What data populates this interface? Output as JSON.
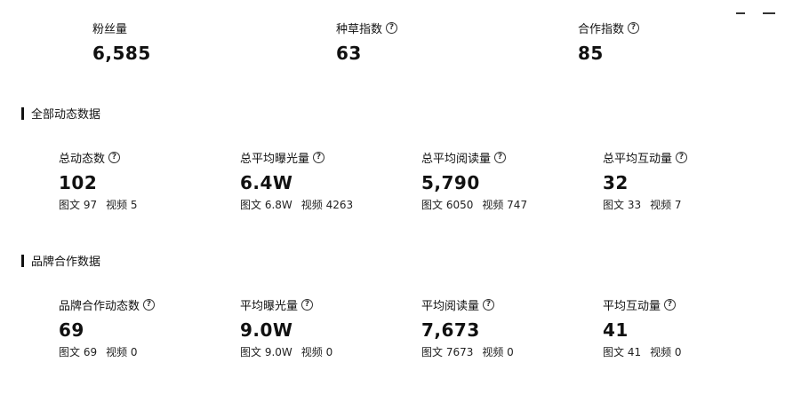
{
  "top_metrics": [
    {
      "label": "粉丝量",
      "value": "6,585",
      "has_help": false
    },
    {
      "label": "种草指数",
      "value": "63",
      "has_help": true
    },
    {
      "label": "合作指数",
      "value": "85",
      "has_help": true
    }
  ],
  "sections": [
    {
      "title": "全部动态数据",
      "metrics": [
        {
          "label": "总动态数",
          "value": "102",
          "sub_left": "图文 97",
          "sub_right": "视频 5"
        },
        {
          "label": "总平均曝光量",
          "value": "6.4W",
          "sub_left": "图文 6.8W",
          "sub_right": "视频 4263"
        },
        {
          "label": "总平均阅读量",
          "value": "5,790",
          "sub_left": "图文 6050",
          "sub_right": "视频 747"
        },
        {
          "label": "总平均互动量",
          "value": "32",
          "sub_left": "图文 33",
          "sub_right": "视频 7"
        }
      ]
    },
    {
      "title": "品牌合作数据",
      "metrics": [
        {
          "label": "品牌合作动态数",
          "value": "69",
          "sub_left": "图文 69",
          "sub_right": "视频 0"
        },
        {
          "label": "平均曝光量",
          "value": "9.0W",
          "sub_left": "图文 9.0W",
          "sub_right": "视频 0"
        },
        {
          "label": "平均阅读量",
          "value": "7,673",
          "sub_left": "图文 7673",
          "sub_right": "视频 0"
        },
        {
          "label": "平均互动量",
          "value": "41",
          "sub_left": "图文 41",
          "sub_right": "视频 0"
        }
      ]
    }
  ],
  "help_icon_glyph": "?"
}
